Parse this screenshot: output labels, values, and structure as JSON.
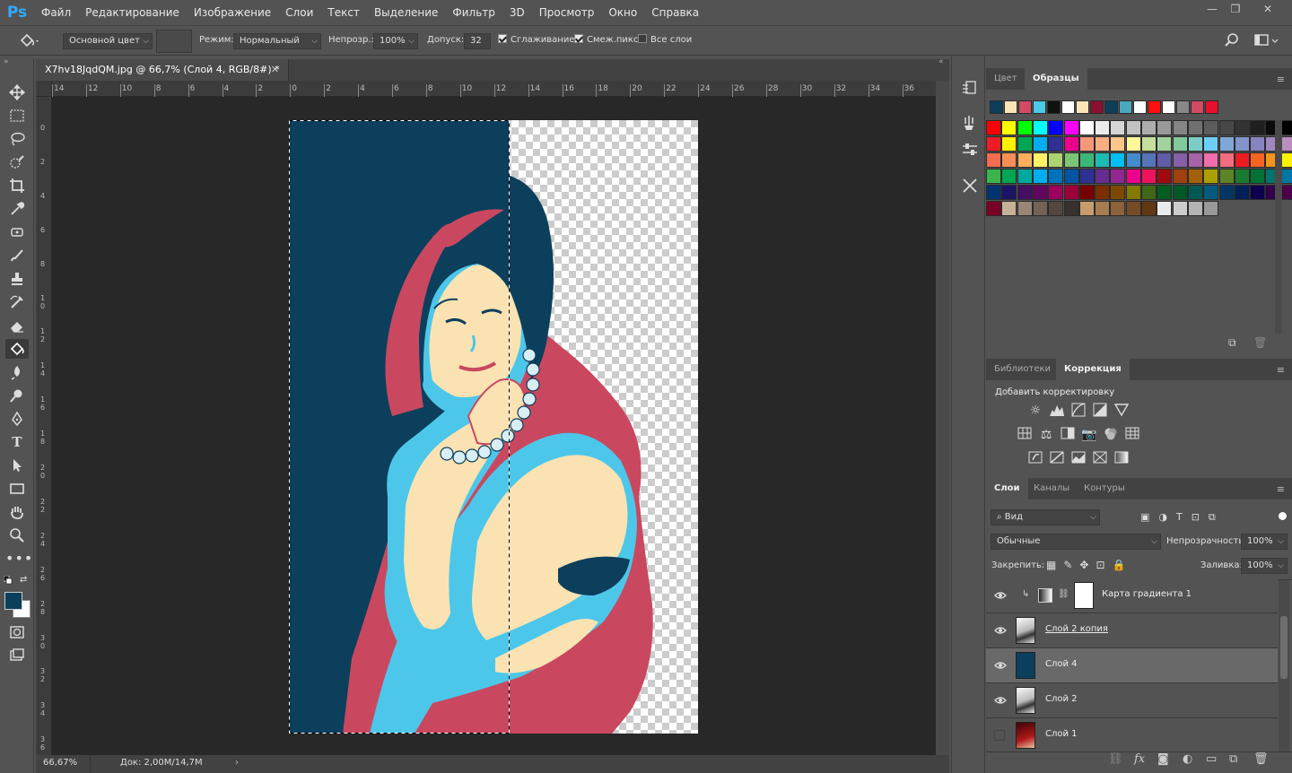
{
  "app": {
    "logo": "Ps"
  },
  "menu": [
    "Файл",
    "Редактирование",
    "Изображение",
    "Слои",
    "Текст",
    "Выделение",
    "Фильтр",
    "3D",
    "Просмотр",
    "Окно",
    "Справка"
  ],
  "window_controls": [
    "—",
    "❐",
    "✕"
  ],
  "options": {
    "fill_source": "Основной цвет",
    "mode_label": "Режим:",
    "mode_value": "Нормальный",
    "opacity_label": "Непрозр.:",
    "opacity_value": "100%",
    "tolerance_label": "Допуск:",
    "tolerance_value": "32",
    "antialias": "Сглаживание",
    "contiguous": "Смеж.пикс",
    "all_layers": "Все слои"
  },
  "document": {
    "tab_title": "X7hv18JqdQM.jpg @ 66,7% (Слой 4, RGB/8#) *",
    "zoom": "66,67%",
    "doc_info": "Док: 2,00M/14,7M",
    "ruler_h": [
      "14",
      "12",
      "10",
      "8",
      "6",
      "4",
      "2",
      "0",
      "2",
      "4",
      "6",
      "8",
      "10",
      "12",
      "14",
      "16",
      "18",
      "20",
      "22",
      "24",
      "26",
      "28",
      "30",
      "32",
      "34",
      "36"
    ],
    "ruler_v": [
      "0",
      "2",
      "4",
      "6",
      "8",
      "10",
      "12",
      "14",
      "16",
      "18",
      "20",
      "22",
      "24",
      "26",
      "28",
      "30",
      "32",
      "34",
      "36"
    ]
  },
  "swatches_panel": {
    "tabs": [
      "Цвет",
      "Образцы"
    ],
    "active": "Образцы",
    "recent": [
      "#0b3f5c",
      "#fbe5b7",
      "#d04b63",
      "#4bc9e8",
      "#111111",
      "#ffffff",
      "#fbe5b7",
      "#8a1030",
      "#0b3f5c",
      "#4aa8be",
      "#ffffff",
      "#ff1010",
      "#ffffff",
      "#888888",
      "#d04b63",
      "#e8102a"
    ],
    "rows": [
      [
        "#ff0000",
        "#ffff00",
        "#00ff00",
        "#00ffff",
        "#0000ff",
        "#ff00ff",
        "#ffffff",
        "#ebebeb",
        "#d6d6d6",
        "#c2c2c2",
        "#adadad",
        "#999999",
        "#858585",
        "#707070",
        "#5c5c5c",
        "#474747",
        "#333333",
        "#1f1f1f",
        "#0a0a0a",
        "#000000",
        "#ff3b3b"
      ],
      [
        "#ed1c24",
        "#fff200",
        "#00a651",
        "#00aeef",
        "#2e3192",
        "#ec008c",
        "#f7977a",
        "#fbad82",
        "#fdc68a",
        "#fff799",
        "#c4df9b",
        "#a3d39c",
        "#82ca9d",
        "#7bcdc8",
        "#6ecff6",
        "#7ea7d8",
        "#8493ca",
        "#8882be",
        "#a187be",
        "#bc8dbf",
        "#f49ac2"
      ],
      [
        "#f26c4f",
        "#f68e55",
        "#fbaf5c",
        "#fff467",
        "#acd372",
        "#7cc576",
        "#3bb878",
        "#1abbb4",
        "#00bff3",
        "#438ccb",
        "#5574b9",
        "#605ca8",
        "#855fa8",
        "#a763a8",
        "#f06ea9",
        "#f26d7d",
        "#ed1c24",
        "#f26522",
        "#f7941d",
        "#fff200",
        "#8dc73f"
      ],
      [
        "#39b54a",
        "#00a651",
        "#00a99d",
        "#00aeef",
        "#0072bc",
        "#0054a6",
        "#2e3192",
        "#662d91",
        "#92278f",
        "#ec008c",
        "#ed145b",
        "#9e0b0f",
        "#a0410d",
        "#a36209",
        "#aba000",
        "#598527",
        "#1a7b30",
        "#007236",
        "#00746b",
        "#0076a3",
        "#004b80"
      ],
      [
        "#003471",
        "#1b1464",
        "#440e62",
        "#630460",
        "#9e005d",
        "#9e0039",
        "#790000",
        "#7b2e00",
        "#7d4900",
        "#827b00",
        "#406618",
        "#005e20",
        "#005826",
        "#005952",
        "#005b7f",
        "#003663",
        "#002157",
        "#0d004c",
        "#32004b",
        "#4b0049",
        "#7b0046"
      ],
      [
        "#7a0026",
        "#c7b299",
        "#998675",
        "#736357",
        "#534741",
        "#37302d",
        "#c69c6d",
        "#a67c52",
        "#8c6239",
        "#754c24",
        "#603813",
        "#ebebeb",
        "#cccccc",
        "#b3b3b3",
        "#999999"
      ]
    ]
  },
  "adjust_panel": {
    "tabs": [
      "Библиотеки",
      "Коррекция"
    ],
    "active": "Коррекция",
    "title": "Добавить корректировку"
  },
  "layers_panel": {
    "tabs": [
      "Слои",
      "Каналы",
      "Контуры"
    ],
    "active": "Слои",
    "filter": "Вид",
    "blend": "Обычные",
    "opacity_label": "Непрозрачность:",
    "opacity": "100%",
    "lock_label": "Закрепить:",
    "fill_label": "Заливка:",
    "fill": "100%",
    "layers": [
      {
        "name": "Карта градиента 1",
        "visible": true,
        "selected": false,
        "type": "adjustment"
      },
      {
        "name": "Слой 2 копия",
        "visible": true,
        "selected": false,
        "type": "photo-bw"
      },
      {
        "name": "Слой 4",
        "visible": true,
        "selected": true,
        "type": "blue"
      },
      {
        "name": "Слой 2",
        "visible": true,
        "selected": false,
        "type": "photo-bw"
      },
      {
        "name": "Слой 1",
        "visible": false,
        "selected": false,
        "type": "photo-color"
      }
    ],
    "footer_icons": [
      "link-icon",
      "fx-icon",
      "mask-icon",
      "adjustment-icon",
      "folder-icon",
      "new-layer-icon",
      "trash-icon"
    ]
  },
  "colors": {
    "accent": "#31a8ff",
    "fg": "#0b3f5c",
    "bg": "#ffffff",
    "poster_blue": "#0b3f5c",
    "poster_red": "#c9485f",
    "poster_cyan": "#4cc7ea",
    "poster_cream": "#fbe2b2"
  }
}
